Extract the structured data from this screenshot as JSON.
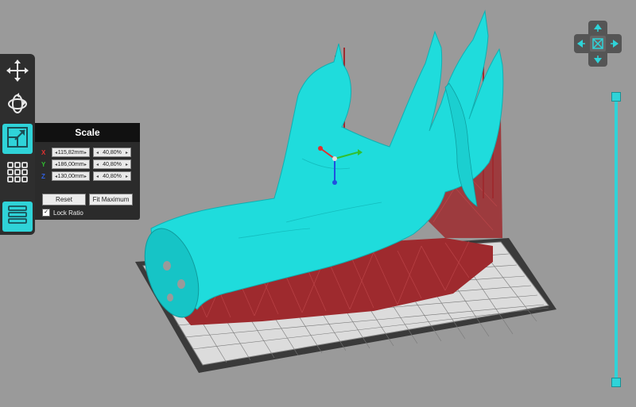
{
  "toolbar": {
    "tools": [
      {
        "name": "move-icon"
      },
      {
        "name": "rotate-icon"
      },
      {
        "name": "scale-icon",
        "active": true
      },
      {
        "name": "arrange-grid-icon"
      },
      {
        "name": "layers-icon",
        "active": true
      }
    ]
  },
  "scale_panel": {
    "title": "Scale",
    "rows": [
      {
        "axis": "X",
        "axis_color": "#e03030",
        "size": "115,82mm",
        "percent": "40,80%"
      },
      {
        "axis": "Y",
        "axis_color": "#30c030",
        "size": "186,00mm",
        "percent": "40,80%"
      },
      {
        "axis": "Z",
        "axis_color": "#3060e0",
        "size": "130,00mm",
        "percent": "40,80%"
      }
    ],
    "reset_label": "Reset",
    "fit_label": "Fit Maximum",
    "lock_ratio_label": "Lock Ratio",
    "lock_ratio_checked": true
  },
  "view_nav": {
    "icon": "view-navigation-cube-icon"
  },
  "layer_slider": {
    "top_value": 1.0,
    "bottom_value": 0.0
  },
  "colors": {
    "accent": "#2fd3d8",
    "model": "#1fdcdc",
    "supports": "#9e2a2e",
    "plate": "#3a3a3a"
  }
}
